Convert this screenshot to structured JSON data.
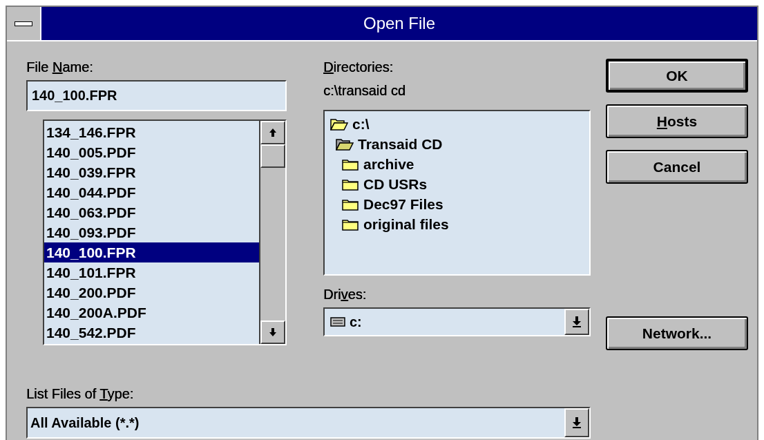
{
  "window": {
    "title": "Open File"
  },
  "file_name": {
    "label": {
      "before": "File ",
      "key": "N",
      "after": "ame:"
    },
    "value": "140_100.FPR"
  },
  "files": [
    {
      "name": "134_146.FPR",
      "selected": false
    },
    {
      "name": "140_005.PDF",
      "selected": false
    },
    {
      "name": "140_039.FPR",
      "selected": false
    },
    {
      "name": "140_044.PDF",
      "selected": false
    },
    {
      "name": "140_063.PDF",
      "selected": false
    },
    {
      "name": "140_093.PDF",
      "selected": false
    },
    {
      "name": "140_100.FPR",
      "selected": true
    },
    {
      "name": "140_101.FPR",
      "selected": false
    },
    {
      "name": "140_200.PDF",
      "selected": false
    },
    {
      "name": "140_200A.PDF",
      "selected": false
    },
    {
      "name": "140_542.PDF",
      "selected": false
    }
  ],
  "directories": {
    "label": {
      "key": "D",
      "after": "irectories:"
    },
    "path": "c:\\transaid cd",
    "tree": [
      {
        "name": "c:\\",
        "expanded": true,
        "selected": false,
        "children": [
          {
            "name": "Transaid CD",
            "expanded": true,
            "selected": true,
            "children": [
              {
                "name": "archive",
                "expanded": false,
                "selected": false
              },
              {
                "name": "CD USRs",
                "expanded": false,
                "selected": false
              },
              {
                "name": "Dec97 Files",
                "expanded": false,
                "selected": false
              },
              {
                "name": "original files",
                "expanded": false,
                "selected": false
              }
            ]
          }
        ]
      }
    ]
  },
  "drives": {
    "label": {
      "before": "Dri",
      "key": "v",
      "after": "es:"
    },
    "value": "c:"
  },
  "file_type": {
    "label": {
      "before": "List Files of ",
      "key": "T",
      "after": "ype:"
    },
    "value": "All Available (*.*)"
  },
  "buttons": [
    {
      "label": {
        "before": "OK"
      },
      "default": true
    },
    {
      "label": {
        "key": "H",
        "after": "osts"
      },
      "default": false
    },
    {
      "label": {
        "before": "Cancel"
      },
      "default": false
    }
  ],
  "network_button": {
    "label": {
      "before": "Network..."
    },
    "default": false
  }
}
